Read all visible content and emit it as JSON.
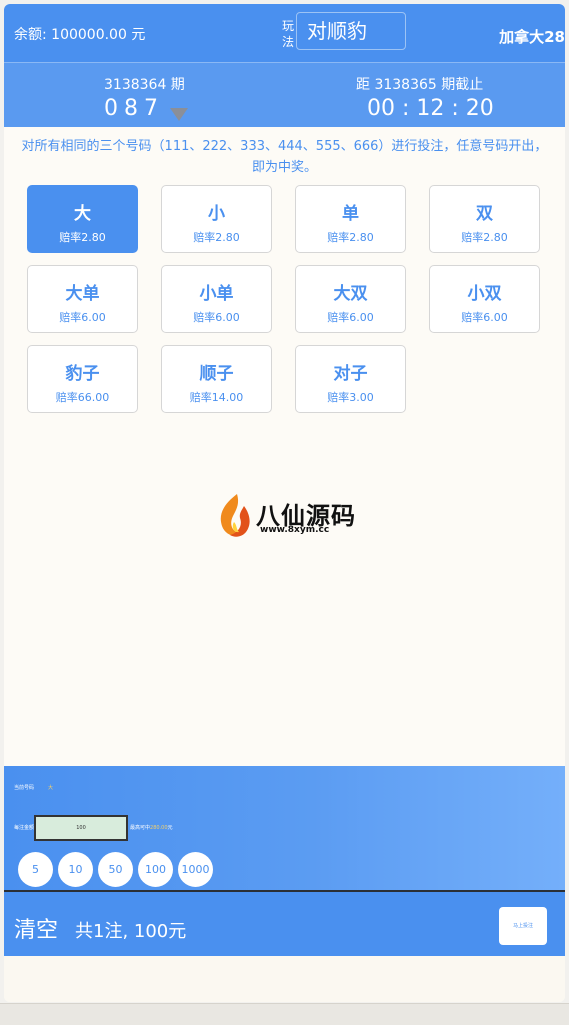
{
  "header": {
    "balance": "余额: 100000.00 元",
    "mode_label": "玩法",
    "mode_value": "对顺豹",
    "region": "加拿大28"
  },
  "period": {
    "current": "3138364 期",
    "current_number": "087",
    "next_label": "距 3138365 期截止",
    "countdown": "00 : 12 : 20"
  },
  "description": "对所有相同的三个号码（111、222、333、444、555、666）进行投注，任意号码开出，即为中奖。",
  "bets": [
    {
      "name": "大",
      "odds": "赔率2.80",
      "active": true
    },
    {
      "name": "小",
      "odds": "赔率2.80",
      "active": false
    },
    {
      "name": "单",
      "odds": "赔率2.80",
      "active": false
    },
    {
      "name": "双",
      "odds": "赔率2.80",
      "active": false
    },
    {
      "name": "大单",
      "odds": "赔率6.00",
      "active": false
    },
    {
      "name": "小单",
      "odds": "赔率6.00",
      "active": false
    },
    {
      "name": "大双",
      "odds": "赔率6.00",
      "active": false
    },
    {
      "name": "小双",
      "odds": "赔率6.00",
      "active": false
    },
    {
      "name": "豹子",
      "odds": "赔率66.00",
      "active": false
    },
    {
      "name": "顺子",
      "odds": "赔率14.00",
      "active": false
    },
    {
      "name": "对子",
      "odds": "赔率3.00",
      "active": false
    }
  ],
  "watermark": {
    "name": "八仙源码",
    "url": "www.8xym.cc"
  },
  "bet_panel": {
    "bet_number_label": "当前号码",
    "bet_number_value": "大",
    "amount_label": "每注金额",
    "amount_value": "100",
    "max_win_label": "最高可中",
    "max_win_value": "280.00",
    "max_win_unit": "元",
    "chips": [
      "5",
      "10",
      "50",
      "100",
      "1000"
    ]
  },
  "footer": {
    "clear": "清空",
    "summary": "共1注, 100元",
    "submit": "马上投注"
  },
  "colors": {
    "primary": "#4a90ef",
    "highlight": "#f3d06b",
    "page_bg": "#fdfbf6"
  }
}
